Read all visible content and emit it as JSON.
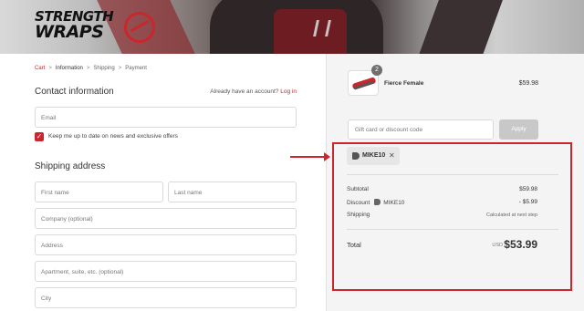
{
  "brand": {
    "line1": "STRENGTH",
    "line2": "WRAPS"
  },
  "breadcrumb": {
    "cart": "Cart",
    "information": "Information",
    "shipping": "Shipping",
    "payment": "Payment"
  },
  "contact": {
    "title": "Contact information",
    "have_account": "Already have an account?",
    "login": "Log in",
    "email_placeholder": "Email",
    "newsletter_label": "Keep me up to date on news and exclusive offers",
    "newsletter_checked": true
  },
  "shipping": {
    "title": "Shipping address",
    "first_name": "First name",
    "last_name": "Last name",
    "company": "Company (optional)",
    "address": "Address",
    "apartment": "Apartment, suite, etc. (optional)",
    "city": "City"
  },
  "order": {
    "quantity": "2",
    "product_name": "Fierce Female",
    "product_price": "$59.98",
    "gift_placeholder": "Gift card or discount code",
    "apply_label": "Apply",
    "discount_tag": "MIKE10",
    "remove_symbol": "✕",
    "subtotal_label": "Subtotal",
    "subtotal_value": "$59.98",
    "discount_label": "Discount",
    "discount_code": "MIKE10",
    "discount_value": "- $5.99",
    "shipping_label": "Shipping",
    "shipping_value": "Calculated at next step",
    "total_label": "Total",
    "currency": "USD",
    "total_value": "$53.99"
  },
  "colors": {
    "accent": "#c9262d",
    "apply_disabled": "#c8c8c8",
    "summary_bg": "#f4f4f4"
  },
  "icons": [
    "chevron-right-icon",
    "checkmark-icon",
    "discount-tag-icon",
    "close-icon",
    "annotation-arrow"
  ]
}
